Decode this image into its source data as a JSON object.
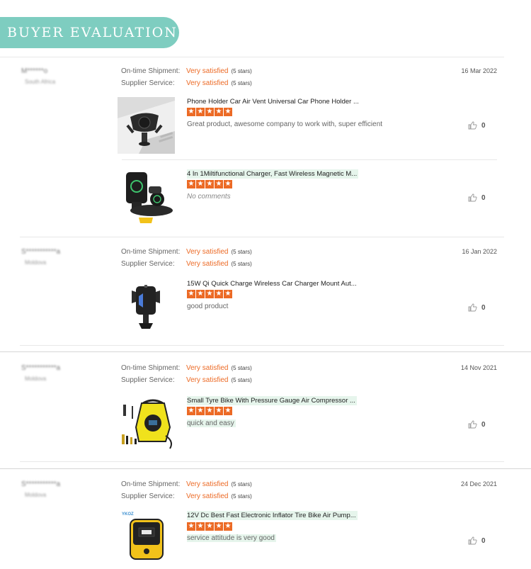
{
  "header": {
    "title": "BUYER EVALUATION"
  },
  "labels": {
    "shipment": "On-time Shipment:",
    "service": "Supplier Service:"
  },
  "colors": {
    "banner": "#7ecdc0",
    "accent": "#ec6a25",
    "highlight": "#e6f5ec"
  },
  "reviews": [
    {
      "name": "M******o",
      "country": "South Africa",
      "date": "16 Mar 2022",
      "shipment_value": "Very satisfied",
      "shipment_stars": "(5 stars)",
      "service_value": "Very satisfied",
      "service_stars": "(5 stars)",
      "products": [
        {
          "title": "Phone Holder Car Air Vent Universal Car Phone Holder ...",
          "stars": 5,
          "comment": "Great product, awesome company to work with, super efficient",
          "likes": "0",
          "image": "phone-holder-image"
        },
        {
          "title": "4 In 1Miltifunctional Charger, Fast Wireless Magnetic M...",
          "stars": 5,
          "comment": "No comments",
          "likes": "0",
          "image": "wireless-charger-image"
        }
      ]
    },
    {
      "name": "S***********a",
      "country": "Moldova",
      "date": "16 Jan 2022",
      "shipment_value": "Very satisfied",
      "shipment_stars": "(5 stars)",
      "service_value": "Very satisfied",
      "service_stars": "(5 stars)",
      "products": [
        {
          "title": "15W Qi Quick Charge Wireless Car Charger Mount Aut...",
          "stars": 5,
          "comment": "good product",
          "likes": "0",
          "image": "car-charger-mount-image"
        }
      ]
    },
    {
      "name": "S***********a",
      "country": "Moldova",
      "date": "14 Nov 2021",
      "shipment_value": "Very satisfied",
      "shipment_stars": "(5 stars)",
      "service_value": "Very satisfied",
      "service_stars": "(5 stars)",
      "products": [
        {
          "title": "Small Tyre Bike With Pressure Gauge Air Compressor ...",
          "stars": 5,
          "comment": "quick and easy",
          "likes": "0",
          "image": "air-compressor-image"
        }
      ]
    },
    {
      "name": "S***********a",
      "country": "Moldova",
      "date": "24 Dec 2021",
      "shipment_value": "Very satisfied",
      "shipment_stars": "(5 stars)",
      "service_value": "Very satisfied",
      "service_stars": "(5 stars)",
      "products": [
        {
          "title": "12V Dc Best Fast Electronic Inflator Tire Bike Air Pump...",
          "stars": 5,
          "comment": "service attitude is very good",
          "likes": "0",
          "image": "tire-inflator-image",
          "brand": "YKOZ"
        }
      ]
    }
  ]
}
